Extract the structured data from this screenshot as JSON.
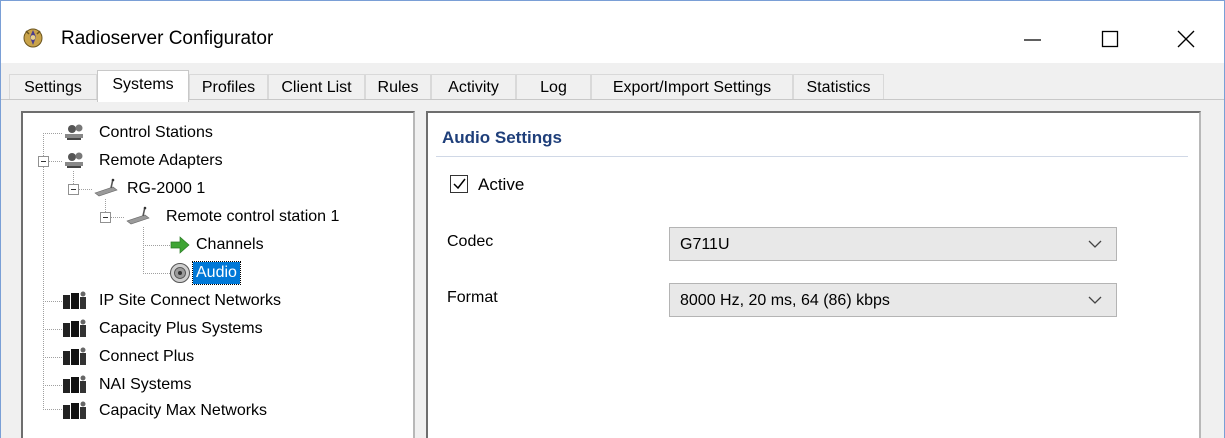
{
  "window": {
    "title": "Radioserver Configurator",
    "controls": [
      "minimize",
      "maximize",
      "close"
    ]
  },
  "tabs": [
    {
      "label": "Settings",
      "active": false
    },
    {
      "label": "Systems",
      "active": true
    },
    {
      "label": "Profiles",
      "active": false
    },
    {
      "label": "Client List",
      "active": false
    },
    {
      "label": "Rules",
      "active": false
    },
    {
      "label": "Activity",
      "active": false
    },
    {
      "label": "Log",
      "active": false
    },
    {
      "label": "Export/Import Settings",
      "active": false
    },
    {
      "label": "Statistics",
      "active": false
    }
  ],
  "tree": {
    "items": [
      {
        "label": "Control Stations",
        "icon": "radio-network-icon"
      },
      {
        "label": "Remote Adapters",
        "icon": "radio-network-icon",
        "expanded": true
      },
      {
        "label": "RG-2000 1",
        "icon": "gateway-device-icon",
        "expanded": true
      },
      {
        "label": "Remote control station 1",
        "icon": "gateway-device-icon",
        "expanded": true
      },
      {
        "label": "Channels",
        "icon": "green-arrow-icon"
      },
      {
        "label": "Audio",
        "icon": "speaker-icon",
        "selected": true
      },
      {
        "label": "IP Site Connect Networks",
        "icon": "network-server-icon"
      },
      {
        "label": "Capacity Plus Systems",
        "icon": "network-server-icon"
      },
      {
        "label": "Connect Plus",
        "icon": "network-server-icon"
      },
      {
        "label": "NAI Systems",
        "icon": "network-server-icon"
      },
      {
        "label": "Capacity Max Networks",
        "icon": "network-server-icon"
      }
    ]
  },
  "audio_settings": {
    "title": "Audio Settings",
    "active_label": "Active",
    "active_checked": true,
    "codec_label": "Codec",
    "codec_value": "G711U",
    "format_label": "Format",
    "format_value": "8000 Hz, 20 ms, 64 (86) kbps"
  },
  "colors": {
    "selection": "#0078d7",
    "section_title": "#1f3f7a",
    "green_arrow": "#3fa535"
  }
}
